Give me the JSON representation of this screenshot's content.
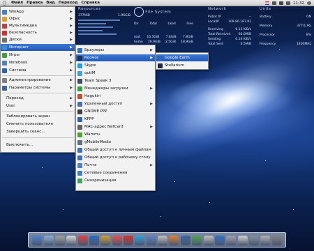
{
  "menubar": {
    "items": [
      "Файл",
      "Правка",
      "Вид",
      "Переход",
      "Справка"
    ],
    "clock": "11:32"
  },
  "conky": {
    "resources": {
      "title": "Resources",
      "labels": [
        "377MiB",
        "1.96GiB"
      ]
    },
    "file_system": {
      "title": "File System",
      "cols": [
        "Dir",
        "Total",
        "Used",
        "Free"
      ],
      "rows": [
        [
          "root",
          "16.5GiB",
          "7.8GiB",
          "7.8GiB"
        ],
        [
          "home",
          "20.9GiB",
          "2.5GiB",
          "18.9GiB"
        ]
      ]
    },
    "network": {
      "title": "Network",
      "rows": [
        [
          "Public IP",
          "--"
        ],
        [
          "LocalIP",
          "109.86.187.83"
        ],
        [
          "Receiving",
          "0.13 KiB/s"
        ],
        [
          "Total Received",
          "64.6MiB"
        ],
        [
          "Sending",
          "0.14 KiB/s"
        ],
        [
          "Total Sent",
          "6.5MiB"
        ]
      ]
    },
    "units": {
      "title": "Units",
      "rows": [
        [
          "Battery",
          "ON"
        ],
        [
          "Memory",
          "377/1.9G"
        ],
        [
          "Processor",
          "8%"
        ],
        [
          "Frequency",
          "1400MHz"
        ]
      ]
    }
  },
  "main_menu": {
    "items": [
      {
        "label": "WinApp",
        "icon_color": "#4a7fd0",
        "arrow": true
      },
      {
        "label": "Офис",
        "icon_color": "#e0a030",
        "arrow": true
      },
      {
        "label": "Мультимедиа",
        "icon_color": "#c04040",
        "arrow": true
      },
      {
        "label": "Безопасность",
        "icon_color": "#d03030",
        "arrow": true
      },
      {
        "label": "Диски",
        "icon_color": "#707070",
        "arrow": true
      },
      {
        "label": "Интернет",
        "icon_color": "#3b8fd8",
        "arrow": true,
        "selected": true
      },
      {
        "label": "Игры",
        "icon_color": "#40a040",
        "arrow": true
      },
      {
        "label": "Notebook",
        "icon_color": "#5080c0",
        "arrow": true
      },
      {
        "label": "Система",
        "icon_color": "#3060b0",
        "arrow": true
      },
      {
        "label": "Администрирование",
        "icon_color": "#808080",
        "arrow": true
      },
      {
        "label": "Параметры системы",
        "icon_color": "#4060a0",
        "arrow": true
      },
      {
        "label": "Переход",
        "icon_color": "",
        "arrow": true
      },
      {
        "label": "User",
        "icon_color": "",
        "arrow": true
      },
      {
        "label": "Заблокировать экран",
        "icon_color": "",
        "arrow": false
      },
      {
        "label": "Сменить пользователя",
        "icon_color": "",
        "arrow": false
      },
      {
        "label": "Завершить сеанс...",
        "icon_color": "",
        "arrow": false
      },
      {
        "label": "Выключить...",
        "icon_color": "",
        "arrow": false
      }
    ]
  },
  "internet_menu": {
    "items": [
      {
        "label": "Браузеры",
        "icon_color": "#3070c8",
        "arrow": true
      },
      {
        "label": "Космос",
        "icon_color": "#20305a",
        "arrow": true,
        "selected": true
      },
      {
        "label": "Skype",
        "icon_color": "#1ea0e0",
        "arrow": false
      },
      {
        "label": "qutIM",
        "icon_color": "#40a0d0",
        "arrow": false
      },
      {
        "label": "Team Speak 3",
        "icon_color": "#405060",
        "arrow": false
      },
      {
        "label": "Менеджеры загрузки",
        "icon_color": "#30a040",
        "arrow": true
      },
      {
        "label": "Hagukiri",
        "icon_color": "#c05030",
        "arrow": false
      },
      {
        "label": "Удаленный доступ",
        "icon_color": "#5070a0",
        "arrow": true
      },
      {
        "label": "GNOME PPP",
        "icon_color": "#404040",
        "arrow": false
      },
      {
        "label": "KPPP",
        "icon_color": "#3060b0",
        "arrow": false
      },
      {
        "label": "MAC-адрес NetCard",
        "icon_color": "#606060",
        "arrow": true
      },
      {
        "label": "Wammu",
        "icon_color": "#50a030",
        "arrow": false
      },
      {
        "label": "gMobileMedia",
        "icon_color": "#607080",
        "arrow": false
      },
      {
        "label": "Общий доступ к личным файлам",
        "icon_color": "#4070b0",
        "arrow": false
      },
      {
        "label": "Общий доступ к рабочему столу",
        "icon_color": "#4070b0",
        "arrow": false
      },
      {
        "label": "Почта",
        "icon_color": "#5080c0",
        "arrow": true
      },
      {
        "label": "Сетевые соединения",
        "icon_color": "#4080c0",
        "arrow": false
      },
      {
        "label": "Синхронизация",
        "icon_color": "#40a060",
        "arrow": false
      }
    ]
  },
  "space_menu": {
    "items": [
      {
        "label": "Google Earth",
        "icon_color": "#2a6ac0",
        "selected": true
      },
      {
        "label": "Stellarium",
        "icon_color": "#202840"
      }
    ]
  },
  "dock": {
    "icon_colors": [
      "#4a7fd0",
      "#8ab0d8",
      "#a0a0a0",
      "#d8d8d8",
      "#e04040",
      "#2a6ac0",
      "#d0a030",
      "#e05050",
      "#d03030",
      "#30a0e0",
      "#6080c0",
      "#c0c0c0",
      "#e08030",
      "#4060a0",
      "#50a050",
      "#c0c0c0",
      "#3070c8",
      "#a0a0b0",
      "#d0d0d0",
      "#8090a0",
      "#b0b0b0",
      "#808080"
    ]
  }
}
